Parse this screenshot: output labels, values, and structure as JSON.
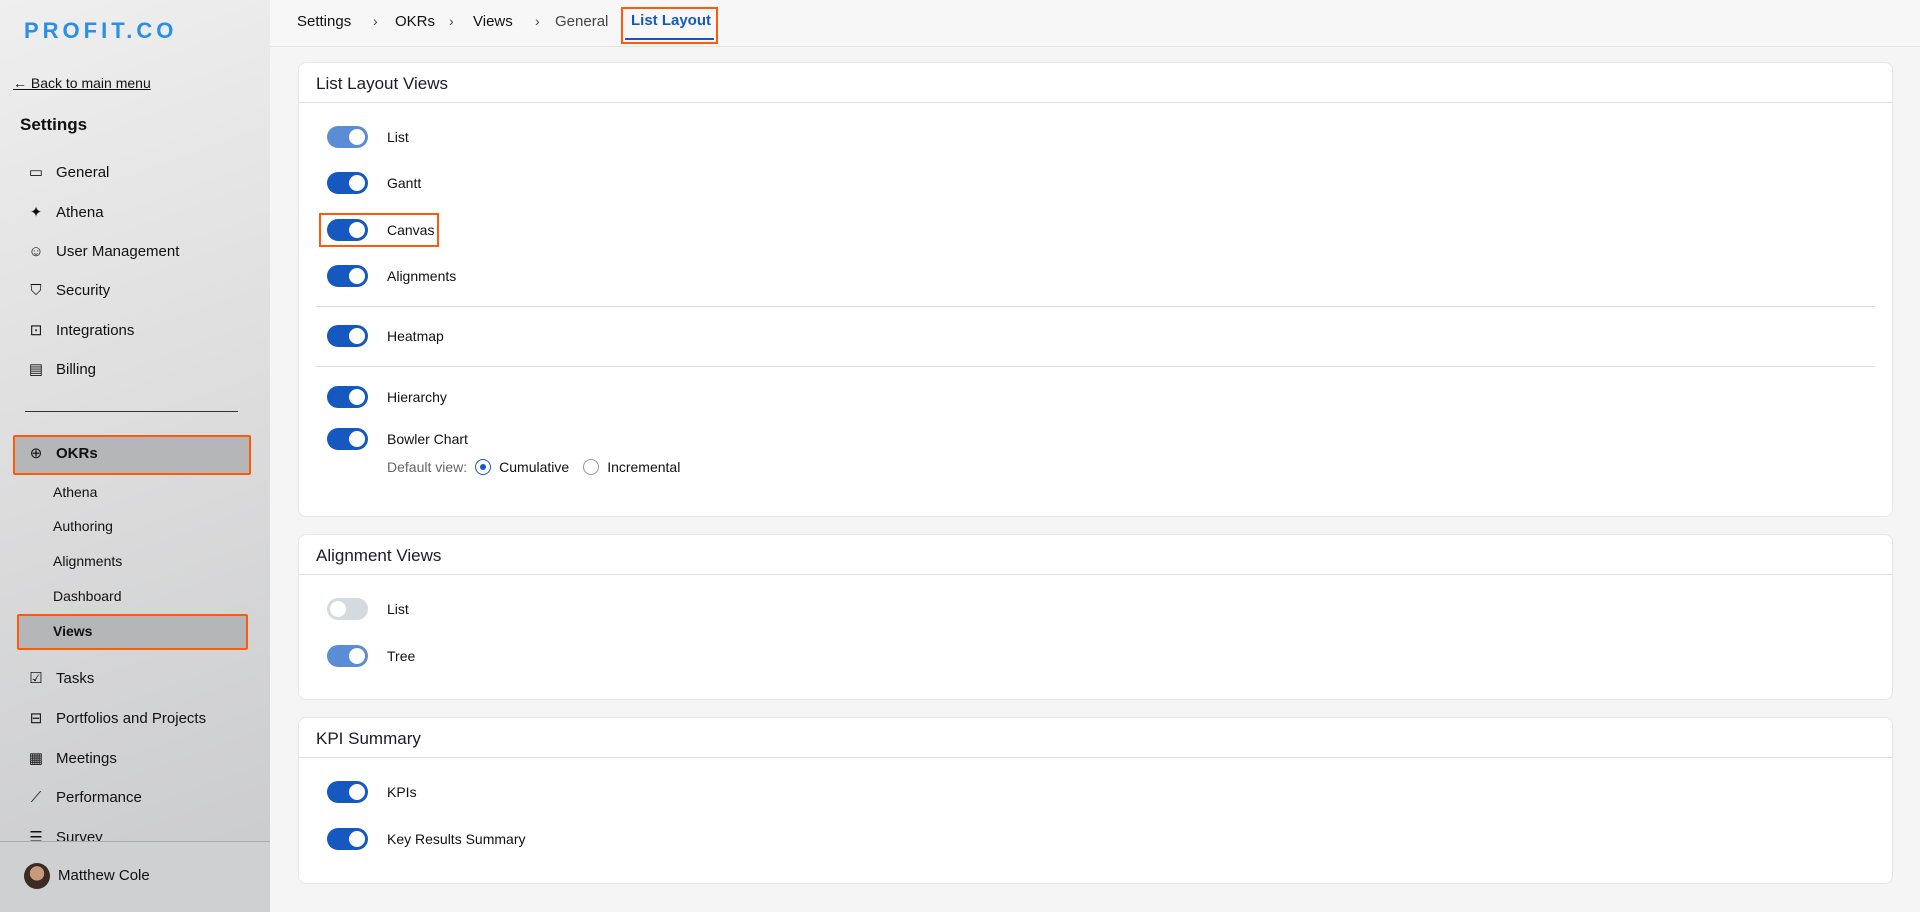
{
  "brand": "PROFIT.CO",
  "sidebar": {
    "back": "← Back to main menu",
    "title": "Settings",
    "items": [
      {
        "label": "General",
        "icon": "monitor-icon"
      },
      {
        "label": "Athena",
        "icon": "sparkle-icon"
      },
      {
        "label": "User Management",
        "icon": "user-icon"
      },
      {
        "label": "Security",
        "icon": "shield-icon"
      },
      {
        "label": "Integrations",
        "icon": "chip-icon"
      },
      {
        "label": "Billing",
        "icon": "receipt-icon"
      }
    ],
    "okrs": {
      "label": "OKRs",
      "icon": "target-icon",
      "children": [
        "Athena",
        "Authoring",
        "Alignments",
        "Dashboard",
        "Views"
      ]
    },
    "more": [
      {
        "label": "Tasks",
        "icon": "clipboard-check-icon"
      },
      {
        "label": "Portfolios and Projects",
        "icon": "briefcase-icon"
      },
      {
        "label": "Meetings",
        "icon": "calendar-icon"
      },
      {
        "label": "Performance",
        "icon": "chart-line-icon"
      },
      {
        "label": "Survey",
        "icon": "list-icon"
      }
    ],
    "user": "Matthew Cole"
  },
  "breadcrumb": [
    "Settings",
    "OKRs",
    "Views"
  ],
  "tabs": [
    "General",
    "List Layout"
  ],
  "cards": {
    "list_layout": {
      "title": "List Layout Views",
      "items": [
        {
          "label": "List",
          "on": true
        },
        {
          "label": "Gantt",
          "on": true
        },
        {
          "label": "Canvas",
          "on": true
        },
        {
          "label": "Alignments",
          "on": true
        },
        {
          "label": "Heatmap",
          "on": true
        },
        {
          "label": "Hierarchy",
          "on": true
        },
        {
          "label": "Bowler Chart",
          "on": true
        }
      ],
      "default_view_label": "Default view:",
      "options": [
        "Cumulative",
        "Incremental"
      ],
      "selected": "Cumulative"
    },
    "alignment": {
      "title": "Alignment Views",
      "items": [
        {
          "label": "List",
          "on": false
        },
        {
          "label": "Tree",
          "on": true
        }
      ]
    },
    "kpi": {
      "title": "KPI Summary",
      "items": [
        {
          "label": "KPIs",
          "on": true
        },
        {
          "label": "Key Results Summary",
          "on": true
        }
      ]
    }
  },
  "colors": {
    "accent": "#1558c0",
    "highlight": "#ff5a0a"
  }
}
